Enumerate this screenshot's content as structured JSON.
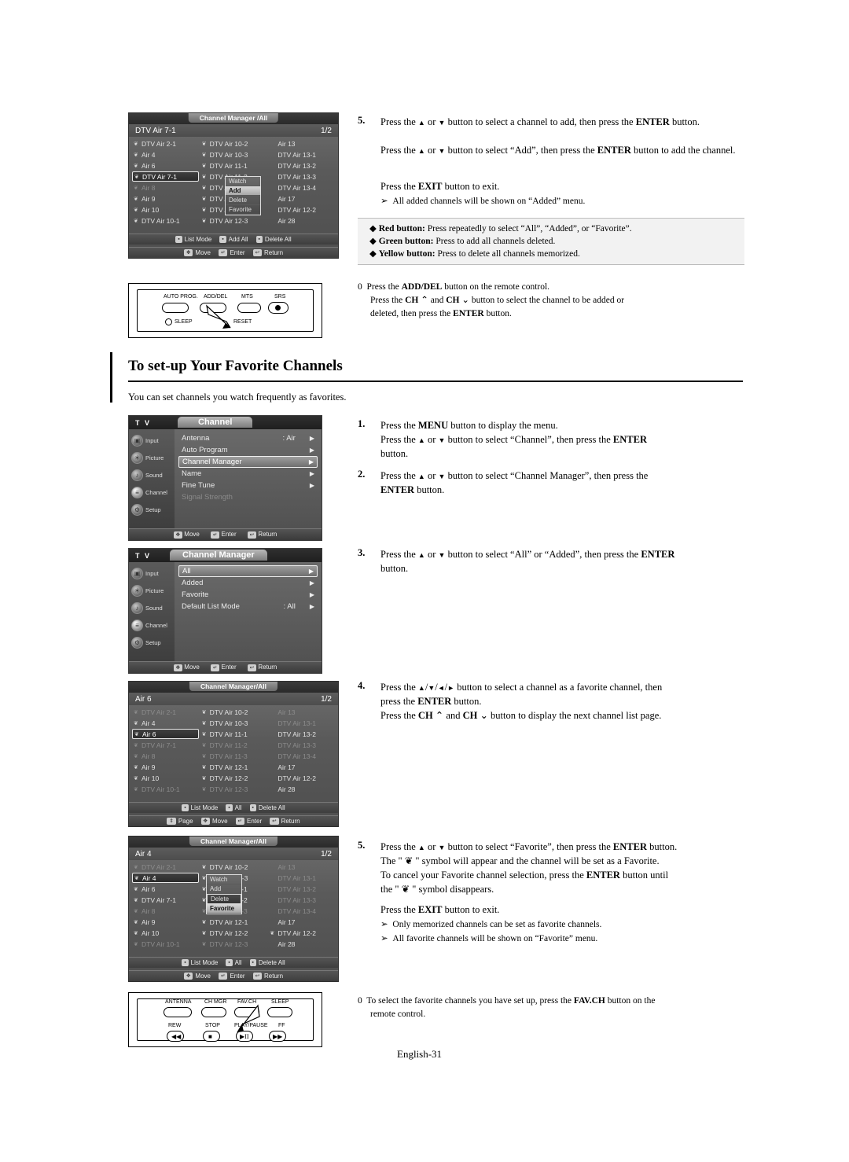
{
  "heading": "To set-up Your Favorite Channels",
  "intro": "You can set channels you watch frequently as favorites.",
  "page_number": "English-31",
  "osd1": {
    "tab": "Channel Manager /All",
    "current": "DTV Air 7-1",
    "page": "1/2",
    "cells": [
      "DTV Air 2-1",
      "DTV Air 10-2",
      "Air 13",
      "Air 4",
      "DTV Air 10-3",
      "DTV Air 13-1",
      "Air 6",
      "DTV Air 11-1",
      "DTV Air 13-2",
      "DTV Air 7-1",
      "DTV Air 11-2",
      "DTV Air 13-3",
      "Air 8",
      "DTV Air 11-3",
      "DTV Air 13-4",
      "Air 9",
      "DTV Air 12-1",
      "Air 17",
      "Air 10",
      "DTV Air 12-2",
      "DTV Air 12-2",
      "DTV Air 10-1",
      "DTV Air 12-3",
      "Air 28"
    ],
    "popup": [
      "Watch",
      "Add",
      "Delete",
      "Favorite"
    ],
    "popup_selected": "Add",
    "bottom": [
      "List Mode",
      "Add All",
      "Delete All"
    ],
    "bottom2": [
      "Move",
      "Enter",
      "Return"
    ]
  },
  "panel1": {
    "labels_top": [
      "AUTO PROG.",
      "ADD/DEL",
      "MTS",
      "SRS"
    ],
    "labels_bottom": [
      "SLEEP",
      "RESET"
    ]
  },
  "steps_top": {
    "n5": "5.",
    "l1_a": "Press the ",
    "l1_b": " or ",
    "l1_c": " button to select a channel to add, then press the ",
    "l1_enter": "ENTER",
    "l1_d": " button.",
    "l2_a": "Press the ",
    "l2_b": " or ",
    "l2_c": " button to select “Add”, then press the ",
    "l2_enter": "ENTER",
    "l2_d": " button to add the channel.",
    "l3_a": "Press the ",
    "l3_exit": "EXIT",
    "l3_b": " button to exit.",
    "note": "All added channels will be shown on “Added” menu."
  },
  "color_notes": [
    {
      "label": "Red button:",
      "text": "Press repeatedly to select “All”, “Added”, or “Favorite”."
    },
    {
      "label": "Green button:",
      "text": "Press to add all channels deleted."
    },
    {
      "label": "Yellow button:",
      "text": "Press to delete all channels memorized."
    }
  ],
  "remote_note": {
    "l1_a": "Press the ",
    "l1_b": "ADD/DEL",
    "l1_c": " button on the remote control.",
    "l2_a": "Press the ",
    "l2_ch1": "CH",
    "l2_b": " and ",
    "l2_ch2": "CH",
    "l2_c": " button to select the channel to be added or",
    "l3_a": "deleted, then press the ",
    "l3_enter": "ENTER",
    "l3_b": " button."
  },
  "menu_channel": {
    "tv": "T V",
    "title": "Channel",
    "rail": [
      "Input",
      "Picture",
      "Sound",
      "Channel",
      "Setup"
    ],
    "rows": [
      {
        "label": "Antenna",
        "value": ": Air",
        "sel": false,
        "dim": false
      },
      {
        "label": "Auto Program",
        "value": "",
        "sel": false,
        "dim": false
      },
      {
        "label": "Channel Manager",
        "value": "",
        "sel": true,
        "dim": false
      },
      {
        "label": "Name",
        "value": "",
        "sel": false,
        "dim": false
      },
      {
        "label": "Fine Tune",
        "value": "",
        "sel": false,
        "dim": false
      },
      {
        "label": "Signal Strength",
        "value": "",
        "sel": false,
        "dim": true
      }
    ],
    "bottom": [
      "Move",
      "Enter",
      "Return"
    ]
  },
  "menu_cm": {
    "tv": "T V",
    "title": "Channel Manager",
    "rail": [
      "Input",
      "Picture",
      "Sound",
      "Channel",
      "Setup"
    ],
    "rows": [
      {
        "label": "All",
        "value": "",
        "sel": true,
        "dim": false
      },
      {
        "label": "Added",
        "value": "",
        "sel": false,
        "dim": false
      },
      {
        "label": "Favorite",
        "value": "",
        "sel": false,
        "dim": false
      },
      {
        "label": "Default List Mode",
        "value": ": All",
        "sel": false,
        "dim": false
      }
    ],
    "bottom": [
      "Move",
      "Enter",
      "Return"
    ]
  },
  "steps_mid": [
    {
      "n": "1.",
      "lines": [
        "Press the MENU button to display the menu.",
        "Press the ▲ or ▼ button to select “Channel”, then press the ENTER",
        "button."
      ]
    },
    {
      "n": "2.",
      "lines": [
        "Press the ▲ or ▼ button to select “Channel Manager”, then press the",
        "ENTER button."
      ]
    },
    {
      "n": "3.",
      "lines": [
        "Press the ▲ or ▼ button to select “All” or “Added”, then press the ENTER",
        "button."
      ]
    }
  ],
  "osd2": {
    "tab": "Channel Manager/All",
    "current": "Air 6",
    "page": "1/2",
    "cells": [
      "DTV Air 2-1",
      "DTV Air 10-2",
      "Air 13",
      "Air 4",
      "DTV Air 10-3",
      "DTV Air 13-1",
      "Air 6",
      "DTV Air 11-1",
      "DTV Air 13-2",
      "DTV Air 7-1",
      "DTV Air 11-2",
      "DTV Air 13-3",
      "Air 8",
      "DTV Air 11-3",
      "DTV Air 13-4",
      "Air 9",
      "DTV Air 12-1",
      "Air 17",
      "Air 10",
      "DTV Air 12-2",
      "DTV Air 12-2",
      "DTV Air 10-1",
      "DTV Air 12-3",
      "Air 28"
    ],
    "bottom": [
      "List Mode",
      "All",
      "Delete All"
    ],
    "bottom2": [
      "Page",
      "Move",
      "Enter",
      "Return"
    ]
  },
  "step4": {
    "n": "4.",
    "lines": [
      "Press the ▲/▼/◄/► button to select a channel as a favorite channel, then",
      "press the ENTER button.",
      "Press the CH ⌃ and CH ⌄ button to display the next channel list page."
    ]
  },
  "osd3": {
    "tab": "Channel Manager/All",
    "current": "Air 4",
    "page": "1/2",
    "cells": [
      "DTV Air 2-1",
      "DTV Air 10-2",
      "Air 13",
      "Air 4",
      "DTV Air 10-3",
      "DTV Air 13-1",
      "Air 6",
      "DTV Air 11-1",
      "DTV Air 13-2",
      "DTV Air 7-1",
      "DTV Air 11-2",
      "DTV Air 13-3",
      "Air 8",
      "DTV Air 11-3",
      "DTV Air 13-4",
      "Air 9",
      "DTV Air 12-1",
      "Air 17",
      "Air 10",
      "DTV Air 12-2",
      "DTV Air 12-2",
      "DTV Air 10-1",
      "DTV Air 12-3",
      "Air 28"
    ],
    "popup": [
      "Watch",
      "Add",
      "Delete",
      "Favorite"
    ],
    "popup_selected": "Favorite",
    "bottom": [
      "List Mode",
      "All",
      "Delete All"
    ],
    "bottom2": [
      "Move",
      "Enter",
      "Return"
    ]
  },
  "step5b": {
    "n": "5.",
    "lines": [
      "Press the ▲ or ▼ button to select “Favorite”, then press the ENTER button.",
      "The \" ❦ \" symbol will appear and the channel will be set as a Favorite.",
      "To cancel your Favorite channel selection, press the ENTER button until",
      "the \" ❦ \" symbol disappears.",
      "Press the EXIT button to exit."
    ],
    "notes": [
      "Only memorized channels can be set as favorite channels.",
      "All favorite channels will be shown on “Favorite” menu."
    ]
  },
  "panel2": {
    "labels_top": [
      "ANTENNA",
      "CH MGR",
      "FAV.CH",
      "SLEEP"
    ],
    "labels_bottom": [
      "REW",
      "STOP",
      "PLAY/PAUSE",
      "FF"
    ]
  },
  "fav_note": {
    "a": "To select the favorite channels you have set up, press the ",
    "b": "FAV.CH",
    "c": " button on the",
    "d": "remote control."
  }
}
